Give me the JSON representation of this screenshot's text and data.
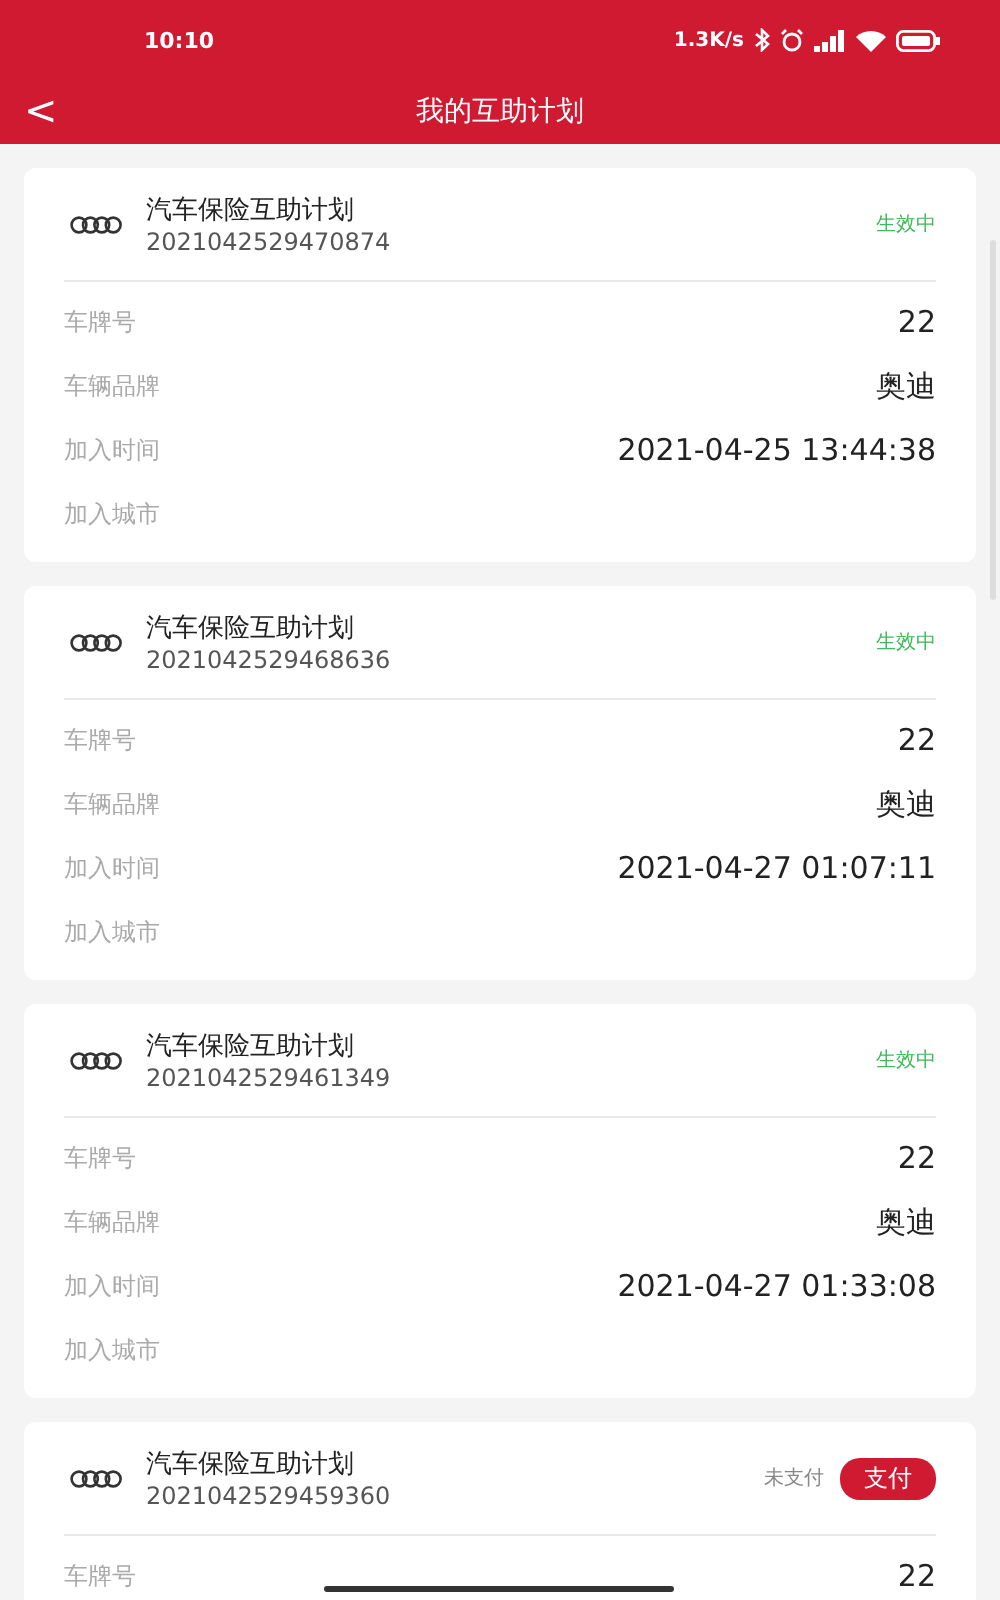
{
  "status_bar": {
    "time": "10:10",
    "speed": "1.3K/s"
  },
  "nav": {
    "back": "<",
    "title": "我的互助计划"
  },
  "plans": [
    {
      "title": "汽车保险互助计划",
      "number": "2021042529470874",
      "status": {
        "kind": "active",
        "text": "生效中"
      },
      "rows": [
        {
          "label": "车牌号",
          "value": "22"
        },
        {
          "label": "车辆品牌",
          "value": "奥迪"
        },
        {
          "label": "加入时间",
          "value": "2021-04-25 13:44:38"
        },
        {
          "label": "加入城市"
        }
      ]
    },
    {
      "title": "汽车保险互助计划",
      "number": "2021042529468636",
      "status": {
        "kind": "active",
        "text": "生效中"
      },
      "rows": [
        {
          "label": "车牌号",
          "value": "22"
        },
        {
          "label": "车辆品牌",
          "value": "奥迪"
        },
        {
          "label": "加入时间",
          "value": "2021-04-27 01:07:11"
        },
        {
          "label": "加入城市"
        }
      ]
    },
    {
      "title": "汽车保险互助计划",
      "number": "2021042529461349",
      "status": {
        "kind": "active",
        "text": "生效中"
      },
      "rows": [
        {
          "label": "车牌号",
          "value": "22"
        },
        {
          "label": "车辆品牌",
          "value": "奥迪"
        },
        {
          "label": "加入时间",
          "value": "2021-04-27 01:33:08"
        },
        {
          "label": "加入城市"
        }
      ]
    },
    {
      "title": "汽车保险互助计划",
      "number": "2021042529459360",
      "status": {
        "kind": "unpaid",
        "text": "未支付",
        "action": "支付"
      },
      "rows": [
        {
          "label": "车牌号",
          "value": "22"
        }
      ]
    }
  ]
}
